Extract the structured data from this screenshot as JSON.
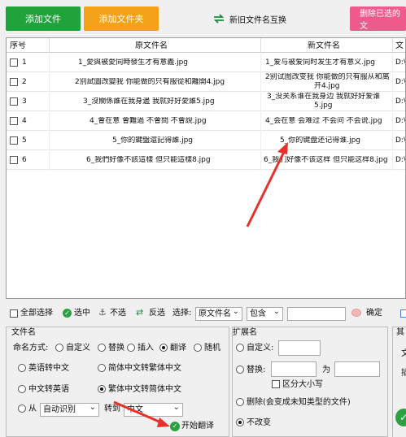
{
  "toolbar": {
    "add_file": "添加文件",
    "add_folder": "添加文件夹",
    "swap_names": "新旧文件名互换",
    "delete_selected": "删除已选的文"
  },
  "table": {
    "headers": [
      "序号",
      "原文件名",
      "新文件名",
      "文"
    ],
    "rows": [
      {
        "num": "1",
        "original": "1_愛與被愛同時發生才有意義.jpg",
        "new": [
          "1_爱与被爱同时发生才有意义.jpg"
        ],
        "path": "D:\\"
      },
      {
        "num": "2",
        "original": "2別試圖改變我 你能做的只有服從和離開4.jpg",
        "new": [
          "2别试图改变我 你能做的只有服从和离",
          "开4.jpg"
        ],
        "path": "D:\\"
      },
      {
        "num": "3",
        "original": "3_沒關係誰在我身邊 我就好好愛誰5.jpg",
        "new": [
          "3_没关系谁在我身边 我就好好爱谁",
          "5.jpg"
        ],
        "path": "D:\\"
      },
      {
        "num": "4",
        "original": "4_會在意 會難過 不會問 不會說.jpg",
        "new": [
          "4_会在意 会难过 不会问 不会说.jpg"
        ],
        "path": "D:\\"
      },
      {
        "num": "5",
        "original": "5_你的鍵盤還記得誰.jpg",
        "new": [
          "5_你的键盘还记得谁.jpg"
        ],
        "path": "D:\\"
      },
      {
        "num": "6",
        "original": "6_我們好像不該這樣 但只能這樣8.jpg",
        "new": [
          "6_我们好像不该这样 但只能这样8.jpg"
        ],
        "path": "D:\\"
      }
    ]
  },
  "selection_bar": {
    "select_all": "全部选择",
    "check": "选中",
    "uncheck": "不选",
    "invert": "反选",
    "select_label": "选择:",
    "field_value": "原文件名",
    "op_value": "包含",
    "confirm": "确定"
  },
  "filename_panel": {
    "title": "文件名",
    "mode_label": "命名方式:",
    "modes": [
      "自定义",
      "替换",
      "插入",
      "翻译",
      "随机"
    ],
    "options": [
      "英语转中文",
      "简体中文转繁体中文",
      "中文转英语",
      "繁体中文转简体中文"
    ],
    "from_label": "从",
    "from_value": "自动识别",
    "to_label": "转到",
    "to_value": "中文",
    "start_button": "开始翻译"
  },
  "ext_panel": {
    "title": "扩展名",
    "custom": "自定义:",
    "replace": "替换:",
    "replace_for": "为",
    "case_sensitive": "区分大小写",
    "delete_ext": "删除(会变成未知类型的文件)",
    "unchanged": "不改变"
  },
  "right_panel": {
    "title": "其",
    "item1": "文",
    "item2": "插"
  },
  "colors": {
    "green": "#1fa33a",
    "orange": "#f3a119",
    "pink": "#ef5b8c",
    "arrow": "#e8312b"
  }
}
